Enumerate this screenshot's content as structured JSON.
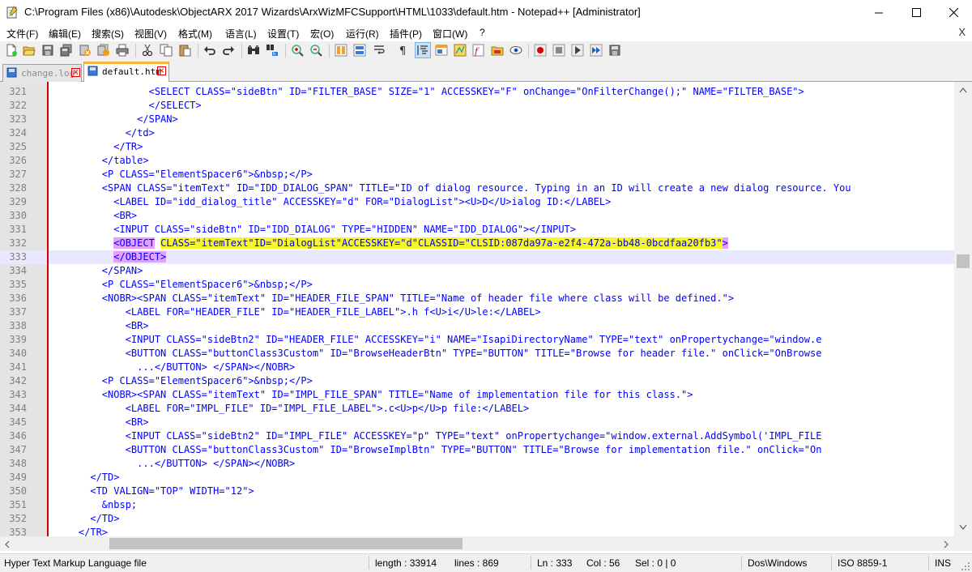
{
  "window": {
    "title": "C:\\Program Files (x86)\\Autodesk\\ObjectARX 2017 Wizards\\ArxWizMFCSupport\\HTML\\1033\\default.htm - Notepad++ [Administrator]",
    "controls": [
      "minimize",
      "maximize",
      "close"
    ]
  },
  "menu": {
    "items": [
      "文件(F)",
      "编辑(E)",
      "搜索(S)",
      "视图(V)",
      "格式(M)",
      "语言(L)",
      "设置(T)",
      "宏(O)",
      "运行(R)",
      "插件(P)",
      "窗口(W)",
      "?"
    ],
    "close_label": "X"
  },
  "toolbar": {
    "icons": [
      "new-file-icon",
      "open-file-icon",
      "save-icon",
      "save-all-icon",
      "close-icon",
      "close-all-icon",
      "print-icon",
      "cut-icon",
      "copy-icon",
      "paste-icon",
      "undo-icon",
      "redo-icon",
      "find-icon",
      "replace-icon",
      "zoom-in-icon",
      "zoom-out-icon",
      "sync-vertical-icon",
      "sync-horizontal-icon",
      "word-wrap-icon",
      "show-all-chars-icon",
      "indent-guide-icon",
      "udl-icon",
      "doc-map-icon",
      "function-list-icon",
      "folder-as-workspace-icon",
      "monitoring-icon",
      "record-macro-icon",
      "stop-macro-icon",
      "play-macro-icon",
      "run-macro-multiple-icon",
      "save-macro-icon"
    ],
    "active_icon": "indent-guide-icon"
  },
  "tabs": [
    {
      "label": "change.log",
      "active": false
    },
    {
      "label": "default.htm",
      "active": true
    }
  ],
  "editor": {
    "current_line": 333,
    "lines": [
      {
        "num": "321",
        "text": "                <SELECT CLASS=\"sideBtn\" ID=\"FILTER_BASE\" SIZE=\"1\" ACCESSKEY=\"F\" onChange=\"OnFilterChange();\" NAME=\"FILTER_BASE\">"
      },
      {
        "num": "322",
        "text": "                </SELECT>"
      },
      {
        "num": "323",
        "text": "              </SPAN>"
      },
      {
        "num": "324",
        "text": "            </td>"
      },
      {
        "num": "325",
        "text": "          </TR>"
      },
      {
        "num": "326",
        "text": "        </table>"
      },
      {
        "num": "327",
        "text": "        <P CLASS=\"ElementSpacer6\">&nbsp;</P>"
      },
      {
        "num": "328",
        "text": "        <SPAN CLASS=\"itemText\" ID=\"IDD_DIALOG_SPAN\" TITLE=\"ID of dialog resource. Typing in an ID will create a new dialog resource. You"
      },
      {
        "num": "329",
        "text": "          <LABEL ID=\"idd_dialog_title\" ACCESSKEY=\"d\" FOR=\"DialogList\"><U>D</U>ialog ID:</LABEL>"
      },
      {
        "num": "330",
        "text": "          <BR>"
      },
      {
        "num": "331",
        "text": "          <INPUT CLASS=\"sideBtn\" ID=\"IDD_DIALOG\" TYPE=\"HIDDEN\" NAME=\"IDD_DIALOG\"></INPUT>"
      },
      {
        "num": "332",
        "text": "          <OBJECT CLASS=\"itemText\" ID=\"DialogList\" ACCESSKEY=\"d\" CLASSID=\"CLSID:087da97a-e2f4-472a-bb48-0bcdfaa20fb3\">",
        "highlight": true
      },
      {
        "num": "333",
        "text": "          </OBJECT>",
        "highlight_close": true
      },
      {
        "num": "334",
        "text": "        </SPAN>"
      },
      {
        "num": "335",
        "text": "        <P CLASS=\"ElementSpacer6\">&nbsp;</P>"
      },
      {
        "num": "336",
        "text": "        <NOBR><SPAN CLASS=\"itemText\" ID=\"HEADER_FILE_SPAN\" TITLE=\"Name of header file where class will be defined.\">"
      },
      {
        "num": "337",
        "text": "            <LABEL FOR=\"HEADER_FILE\" ID=\"HEADER_FILE_LABEL\">.h f<U>i</U>le:</LABEL>"
      },
      {
        "num": "338",
        "text": "            <BR>"
      },
      {
        "num": "339",
        "text": "            <INPUT CLASS=\"sideBtn2\" ID=\"HEADER_FILE\" ACCESSKEY=\"i\" NAME=\"IsapiDirectoryName\" TYPE=\"text\" onPropertychange=\"window.e"
      },
      {
        "num": "340",
        "text": "            <BUTTON CLASS=\"buttonClass3Custom\" ID=\"BrowseHeaderBtn\" TYPE=\"BUTTON\" TITLE=\"Browse for header file.\" onClick=\"OnBrowse"
      },
      {
        "num": "341",
        "text": "              ...</BUTTON> </SPAN></NOBR>"
      },
      {
        "num": "342",
        "text": "        <P CLASS=\"ElementSpacer6\">&nbsp;</P>"
      },
      {
        "num": "343",
        "text": "        <NOBR><SPAN CLASS=\"itemText\" ID=\"IMPL_FILE_SPAN\" TITLE=\"Name of implementation file for this class.\">"
      },
      {
        "num": "344",
        "text": "            <LABEL FOR=\"IMPL_FILE\" ID=\"IMPL_FILE_LABEL\">.c<U>p</U>p file:</LABEL>"
      },
      {
        "num": "345",
        "text": "            <BR>"
      },
      {
        "num": "346",
        "text": "            <INPUT CLASS=\"sideBtn2\" ID=\"IMPL_FILE\" ACCESSKEY=\"p\" TYPE=\"text\" onPropertychange=\"window.external.AddSymbol('IMPL_FILE"
      },
      {
        "num": "347",
        "text": "            <BUTTON CLASS=\"buttonClass3Custom\" ID=\"BrowseImplBtn\" TYPE=\"BUTTON\" TITLE=\"Browse for implementation file.\" onClick=\"On"
      },
      {
        "num": "348",
        "text": "              ...</BUTTON> </SPAN></NOBR>"
      },
      {
        "num": "349",
        "text": "      </TD>"
      },
      {
        "num": "350",
        "text": "      <TD VALIGN=\"TOP\" WIDTH=\"12\">"
      },
      {
        "num": "351",
        "text": "        &nbsp;"
      },
      {
        "num": "352",
        "text": "      </TD>"
      },
      {
        "num": "353",
        "text": "    </TR>"
      }
    ]
  },
  "status": {
    "file_type": "Hyper Text Markup Language file",
    "length": "length : 33914",
    "lines": "lines : 869",
    "ln": "Ln : 333",
    "col": "Col : 56",
    "sel": "Sel : 0 | 0",
    "eol": "Dos\\Windows",
    "encoding": "ISO 8859-1",
    "mode": "INS"
  }
}
